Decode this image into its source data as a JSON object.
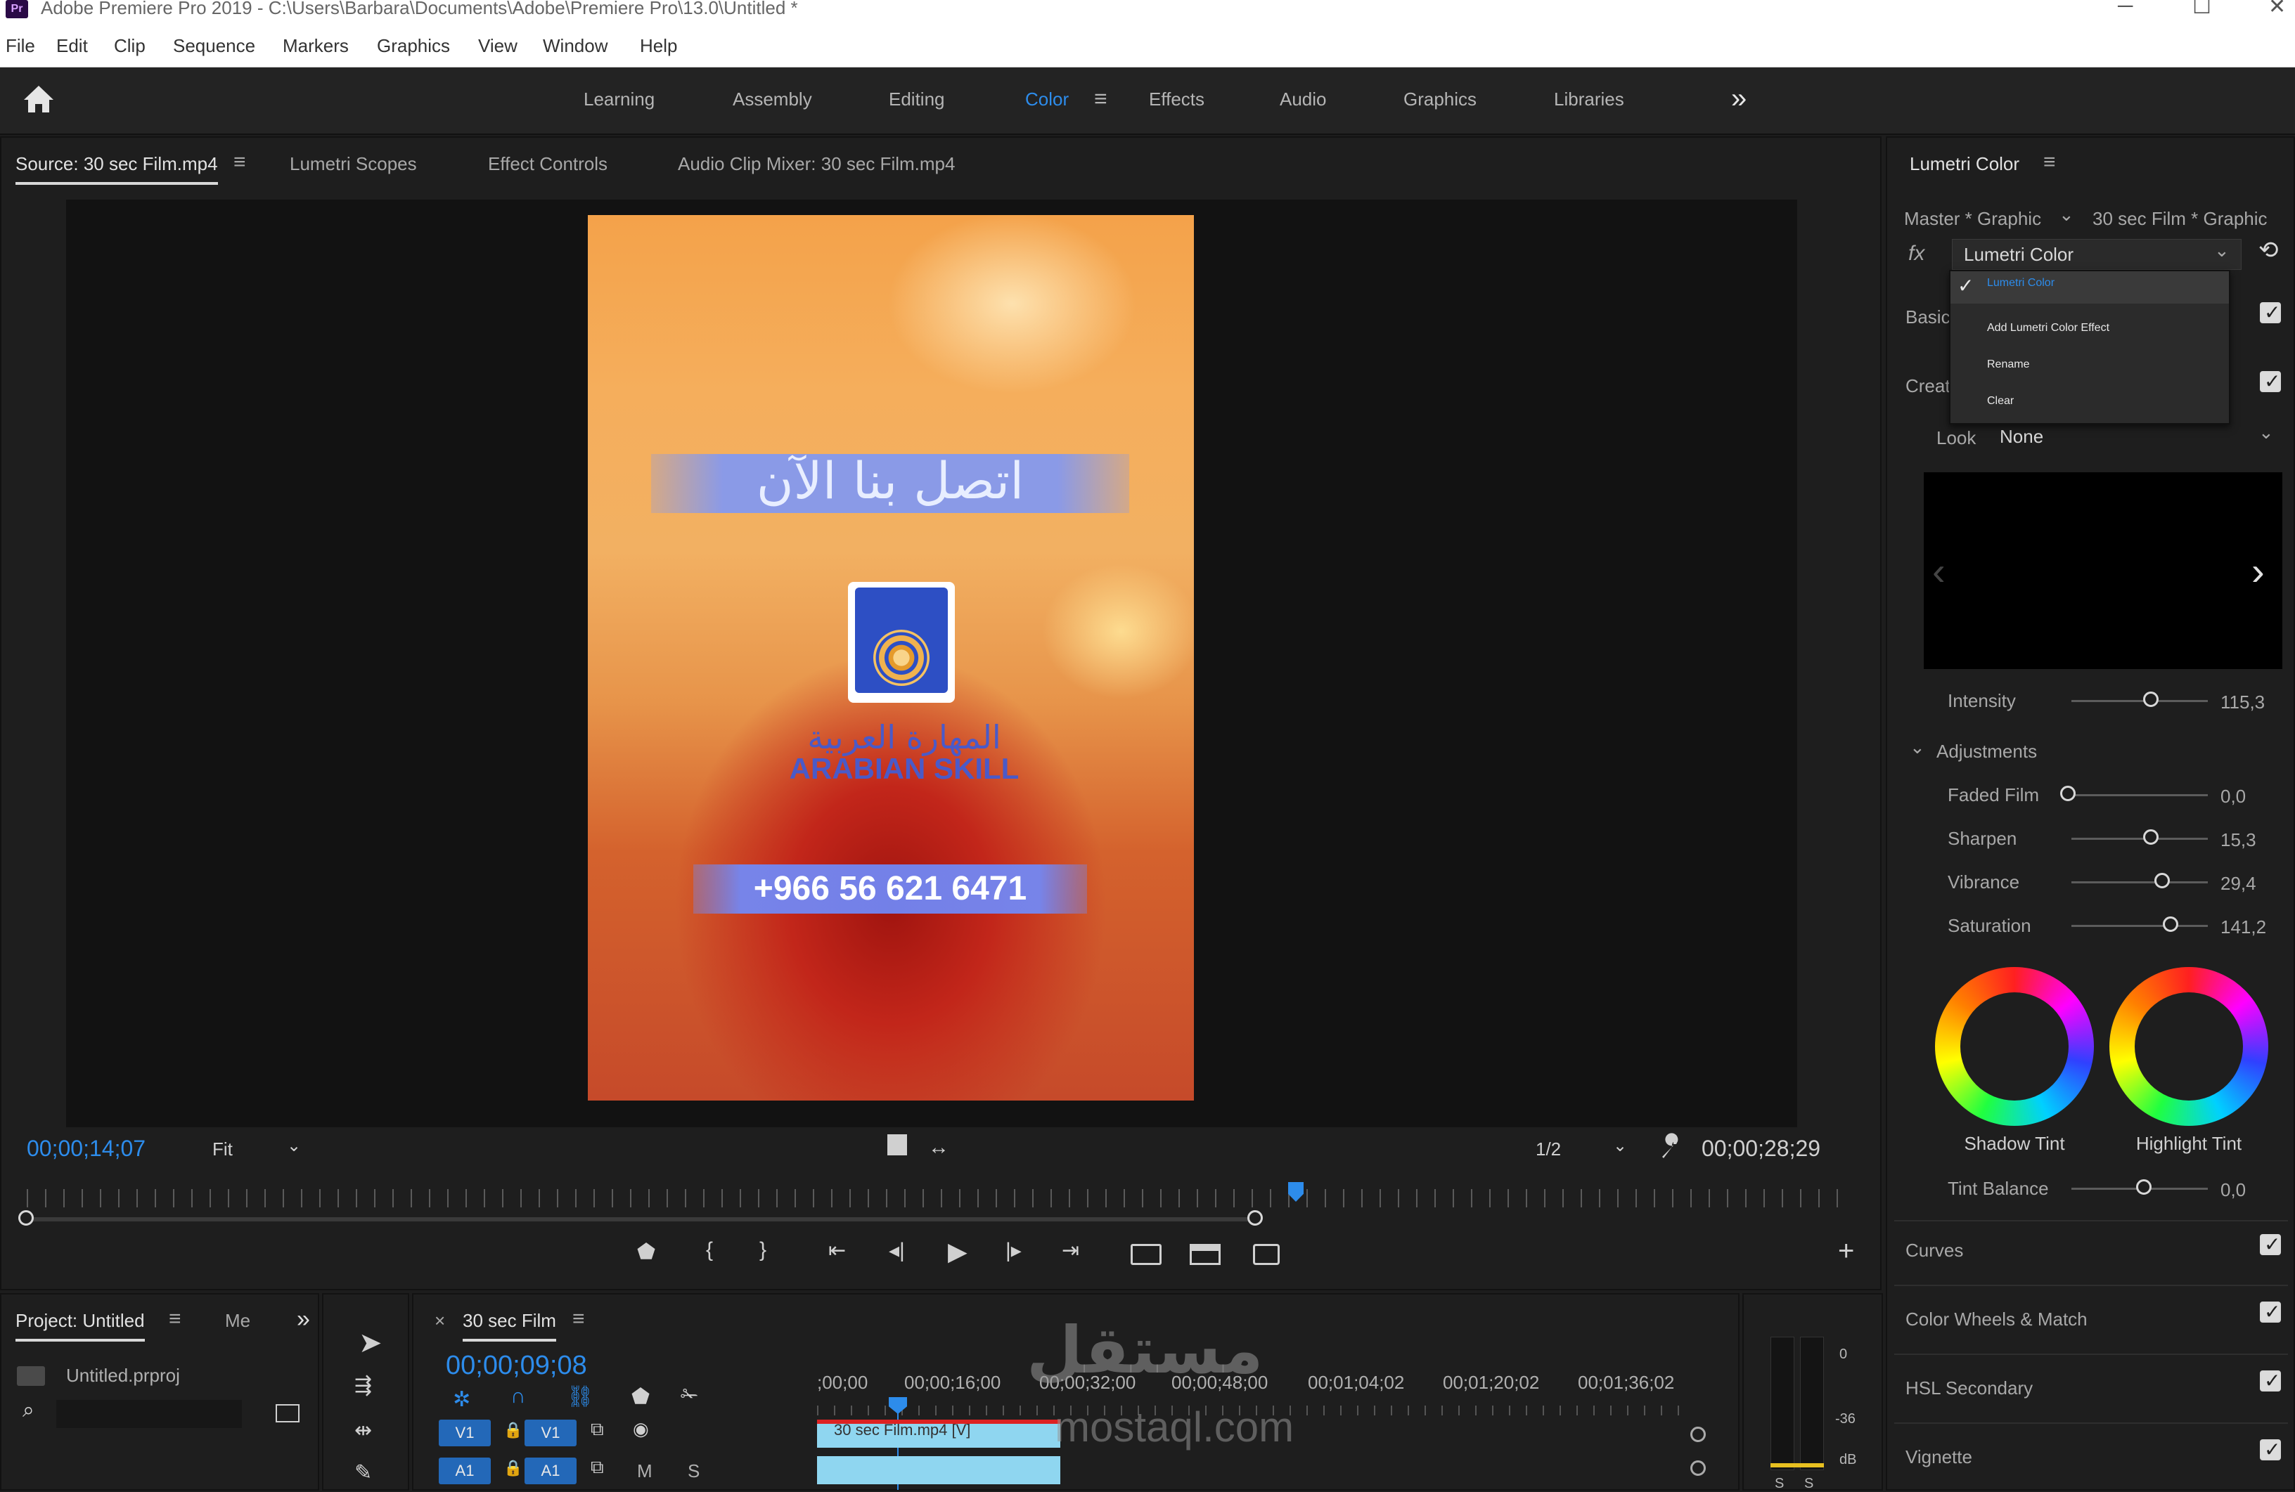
{
  "window": {
    "title": "Adobe Premiere Pro 2019 - C:\\Users\\Barbara\\Documents\\Adobe\\Premiere Pro\\13.0\\Untitled *",
    "app_icon": "Pr",
    "controls": [
      "─",
      "☐",
      "✕"
    ]
  },
  "menu": [
    "File",
    "Edit",
    "Clip",
    "Sequence",
    "Markers",
    "Graphics",
    "View",
    "Window",
    "Help"
  ],
  "workspaces": {
    "items": [
      "Learning",
      "Assembly",
      "Editing",
      "Color",
      "Effects",
      "Audio",
      "Graphics",
      "Libraries"
    ],
    "active": "Color",
    "overflow": "»"
  },
  "source_panel": {
    "tabs": [
      "Source: 30 sec Film.mp4",
      "Lumetri Scopes",
      "Effect Controls",
      "Audio Clip Mixer: 30 sec Film.mp4"
    ],
    "menu_icon": "≡",
    "timecode_current": "00;00;14;07",
    "zoom": "Fit",
    "resolution": "1/2",
    "timecode_duration": "00;00;28;29"
  },
  "video_frame": {
    "headline_ar": "اتصل بنا الآن",
    "brand_ar": "المهارة العربية",
    "brand_en": "ARABIAN SKILL",
    "phone": "+966 56 621 6471"
  },
  "lumetri": {
    "panel_title": "Lumetri Color",
    "master_label": "Master * Graphic",
    "clip_label": "30 sec Film * Graphic",
    "fx_label": "fx",
    "effect_select": "Lumetri Color",
    "dropdown": {
      "selected": "Lumetri Color",
      "items": [
        "Add Lumetri Color Effect",
        "Rename",
        "Clear"
      ]
    },
    "sections_partial": [
      "Basic",
      "Creat"
    ],
    "look_label": "Look",
    "look_value": "None",
    "intensity": {
      "label": "Intensity",
      "value": "115,3",
      "level": 0.58
    },
    "adjustments_label": "Adjustments",
    "sliders": [
      {
        "label": "Faded Film",
        "value": "0,0",
        "level": 0.0
      },
      {
        "label": "Sharpen",
        "value": "15,3",
        "level": 0.58
      },
      {
        "label": "Vibrance",
        "value": "29,4",
        "level": 0.65
      },
      {
        "label": "Saturation",
        "value": "141,2",
        "level": 0.72
      }
    ],
    "wheels": [
      "Shadow Tint",
      "Highlight Tint"
    ],
    "tint_balance": {
      "label": "Tint Balance",
      "value": "0,0",
      "level": 0.5
    },
    "collapsed_sections": [
      "Curves",
      "Color Wheels & Match",
      "HSL Secondary",
      "Vignette"
    ]
  },
  "project_panel": {
    "tab": "Project: Untitled",
    "tab2": "Me",
    "file": "Untitled.prproj"
  },
  "timeline": {
    "sequence": "30 sec Film",
    "timecode": "00;00;09;08",
    "ruler": [
      ";00;00",
      "00;00;16;00",
      "00;00;32;00",
      "00;00;48;00",
      "00;01;04;02",
      "00;01;20;02",
      "00;01;36;02"
    ],
    "tracks": [
      {
        "target": "V1",
        "name": "V1"
      },
      {
        "target": "A1",
        "name": "A1"
      }
    ],
    "clip_label": "30 sec Film.mp4 [V]",
    "track_buttons": [
      "M",
      "S"
    ]
  },
  "meters": {
    "scale": [
      "0",
      "-36",
      "dB"
    ],
    "channels": [
      "S",
      "S"
    ]
  },
  "watermark": {
    "ar": "مستقل",
    "en": "mostaql.com"
  }
}
